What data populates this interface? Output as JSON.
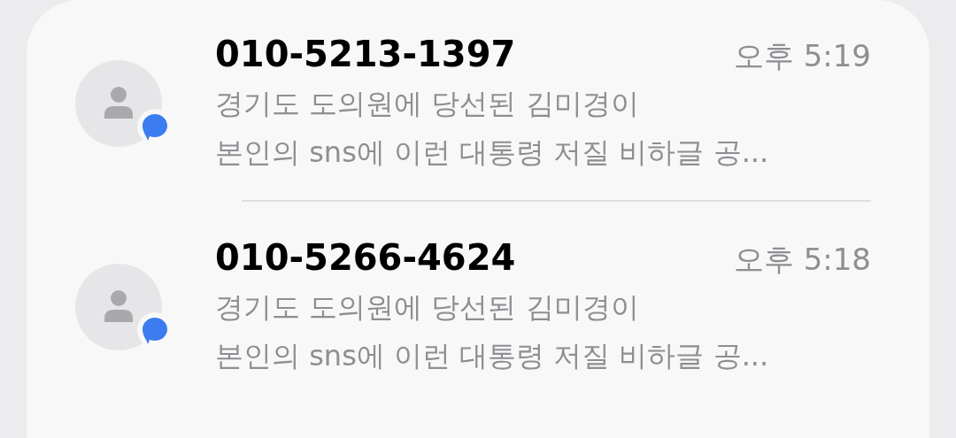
{
  "conversations": [
    {
      "sender": "010-5213-1397",
      "time": "오후 5:19",
      "preview_lines": [
        "경기도 도의원에 당선된 김미경이",
        "본인의 sns에 이런 대통령 저질 비하글 공..."
      ],
      "unread_badge": true
    },
    {
      "sender": "010-5266-4624",
      "time": "오후 5:18",
      "preview_lines": [
        "경기도 도의원에 당선된 김미경이",
        "본인의 sns에 이런 대통령 저질 비하글 공..."
      ],
      "unread_badge": true
    }
  ]
}
